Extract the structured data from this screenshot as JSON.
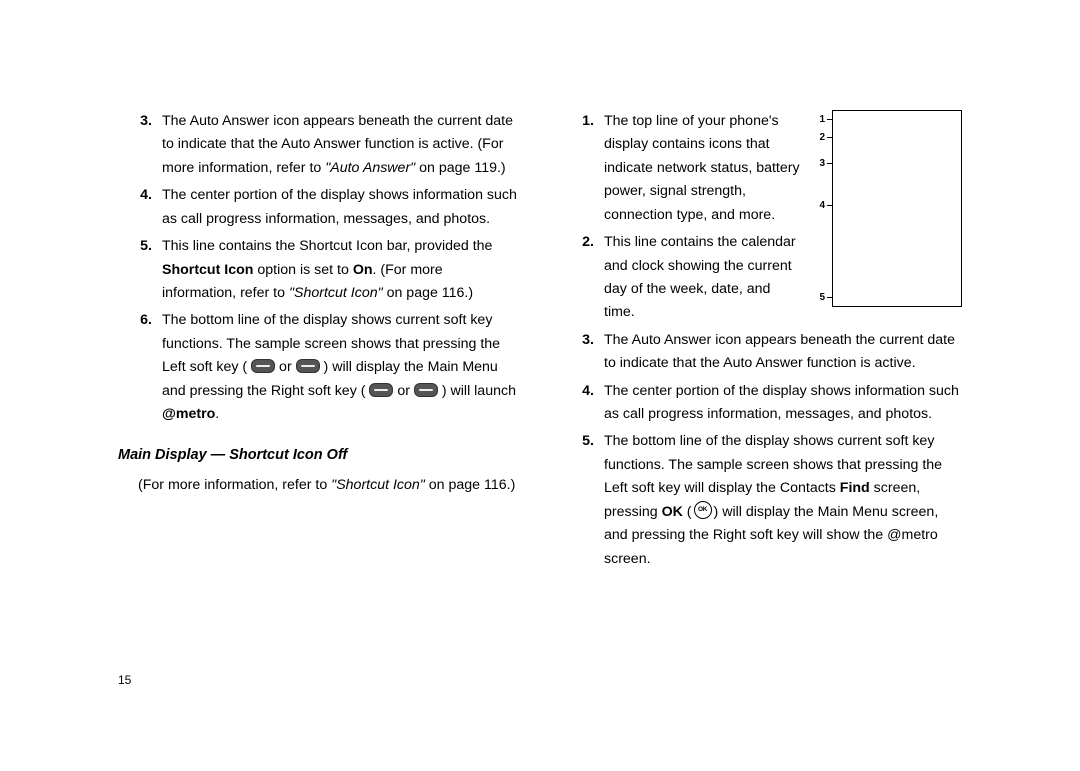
{
  "page_number": "15",
  "left": {
    "items": [
      {
        "num": "3.",
        "text_a": "The Auto Answer icon appears beneath the current date to indicate that the Auto Answer function is active. (For more information, refer to ",
        "ref": "\"Auto Answer\"",
        "text_b": "  on page 119.)"
      },
      {
        "num": "4.",
        "text_a": "The center portion of the display shows information such as call progress information, messages, and photos."
      },
      {
        "num": "5.",
        "text_a": "This line contains the Shortcut Icon bar, provided the ",
        "bold1": "Shortcut Icon",
        "text_b": " option is set to ",
        "bold2": "On",
        "text_c": ". (For more information, refer to ",
        "ref": "\"Shortcut Icon\"",
        "text_d": "  on page 116.)"
      },
      {
        "num": "6.",
        "text_a": "The bottom line of the display shows current soft key functions. The sample screen shows that pressing the Left soft key ( ",
        "icon": true,
        "text_b": " or ",
        "icon2": true,
        "text_c": " ) will display the Main Menu and pressing the Right soft key ( ",
        "icon3": true,
        "text_d": " or ",
        "icon4": true,
        "text_e": " ) will launch ",
        "bold_end": "@metro",
        "text_f": "."
      }
    ],
    "heading": "Main Display — Shortcut Icon Off",
    "note_a": "(For more information, refer to ",
    "note_ref": "\"Shortcut Icon\"",
    "note_b": "  on page 116.)"
  },
  "right": {
    "labels": [
      "1",
      "2",
      "3",
      "4",
      "5"
    ],
    "items": [
      {
        "num": "1.",
        "text": "The top line of your phone's display contains icons that indicate network status, battery power, signal strength, connection type, and more."
      },
      {
        "num": "2.",
        "text": "This line contains the calendar and clock showing the current day of the week, date, and time."
      },
      {
        "num": "3.",
        "text": "The Auto Answer icon appears beneath the current date to indicate that the Auto Answer function is active."
      },
      {
        "num": "4.",
        "text": "The center portion of the display shows information such as call progress information, messages, and photos."
      },
      {
        "num": "5.",
        "text_a": "The bottom line of the display shows current soft key functions. The sample screen shows that pressing the Left soft key will display the Contacts ",
        "bold1": "Find",
        "text_b": " screen, pressing ",
        "bold2": "OK",
        "text_c": " (",
        "ok": true,
        "text_d": ") will display the Main Menu screen, and pressing the Right soft key will show the @metro screen."
      }
    ]
  }
}
